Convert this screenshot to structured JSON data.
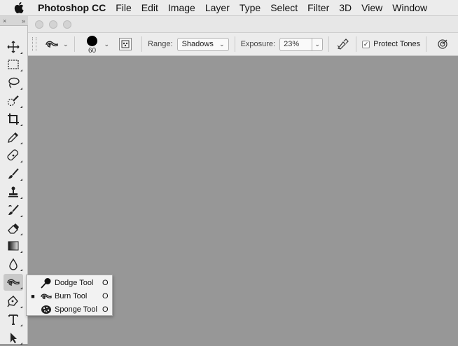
{
  "menubar": {
    "app_name": "Photoshop CC",
    "items": [
      "File",
      "Edit",
      "Image",
      "Layer",
      "Type",
      "Select",
      "Filter",
      "3D",
      "View",
      "Window"
    ]
  },
  "toolstrip": {
    "close_glyph": "×",
    "collapse_glyph": "»"
  },
  "options": {
    "tool_preset_icon": "burn-tool-icon",
    "brush_size": "60",
    "range_label": "Range:",
    "range_value": "Shadows",
    "exposure_label": "Exposure:",
    "exposure_value": "23%",
    "protect_tones_label": "Protect Tones",
    "protect_tones_checked": true
  },
  "toolbar": {
    "tools": [
      "move-tool-icon",
      "rectangular-marquee-icon",
      "lasso-icon",
      "quick-selection-icon",
      "crop-icon",
      "eyedropper-icon",
      "healing-brush-icon",
      "brush-icon",
      "clone-stamp-icon",
      "history-brush-icon",
      "eraser-icon",
      "gradient-icon",
      "blur-icon",
      "burn-tool-icon",
      "pen-icon",
      "type-icon",
      "path-selection-icon"
    ],
    "active_tool": "burn-tool-icon"
  },
  "flyout": {
    "items": [
      {
        "label": "Dodge Tool",
        "shortcut": "O",
        "icon": "dodge-tool-icon",
        "selected": false
      },
      {
        "label": "Burn Tool",
        "shortcut": "O",
        "icon": "burn-tool-icon",
        "selected": true
      },
      {
        "label": "Sponge Tool",
        "shortcut": "O",
        "icon": "sponge-tool-icon",
        "selected": false
      }
    ]
  },
  "colors": {
    "canvas_bg": "#979797",
    "panel_bg": "#ececec"
  }
}
